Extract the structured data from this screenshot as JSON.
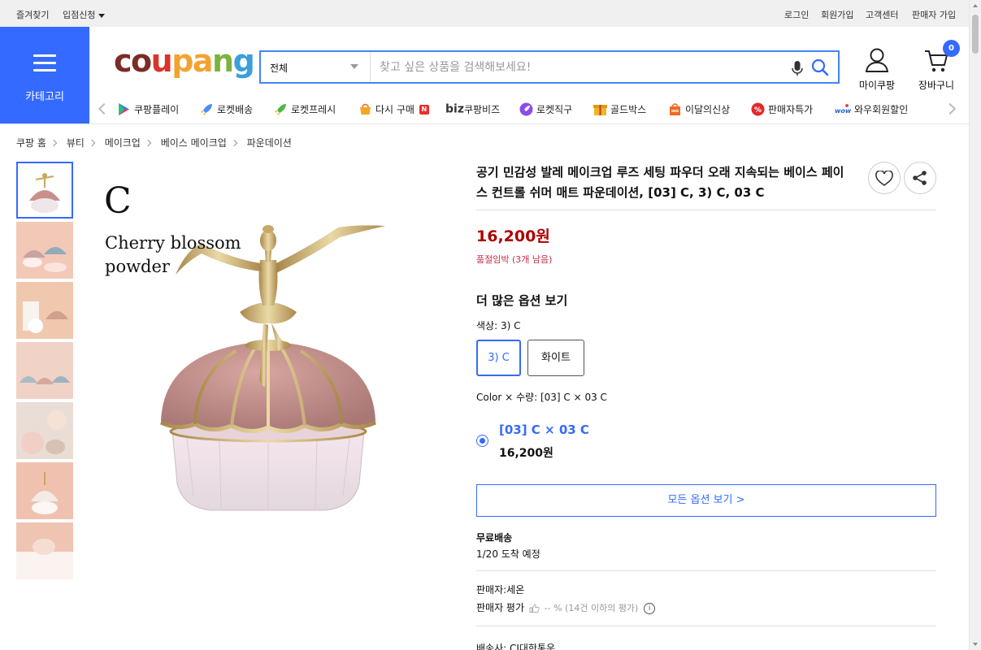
{
  "topbar": {
    "bookmark": "즐겨찾기",
    "seller_apply": "입점신청",
    "login": "로그인",
    "signup": "회원가입",
    "customer_center": "고객센터",
    "seller_signup": "판매자 가입"
  },
  "header": {
    "category_label": "카테고리",
    "logo": [
      "co",
      "u",
      "pa",
      "n",
      "g"
    ],
    "search": {
      "category": "전체",
      "placeholder": "찾고 싶은 상품을 검색해보세요!"
    },
    "mycoupang": "마이쿠팡",
    "cart": "장바구니",
    "cart_count": "0"
  },
  "nav": {
    "items": [
      {
        "label": "쿠팡플레이",
        "icon": "play-icon"
      },
      {
        "label": "로켓배송",
        "icon": "rocket-icon"
      },
      {
        "label": "로켓프레시",
        "icon": "rocket-fresh-icon"
      },
      {
        "label": "다시 구매",
        "icon": "rebuy-icon"
      },
      {
        "label": "쿠팡비즈",
        "icon": "biz-icon"
      },
      {
        "label": "로켓직구",
        "icon": "rocket-global-icon"
      },
      {
        "label": "골드박스",
        "icon": "goldbox-icon"
      },
      {
        "label": "이달의신상",
        "icon": "new-arrival-icon"
      },
      {
        "label": "판매자특가",
        "icon": "discount-icon"
      },
      {
        "label": "와우회원할인",
        "icon": "wow-icon"
      }
    ],
    "biz_prefix": "biz"
  },
  "breadcrumb": [
    "쿠팡 홈",
    "뷰티",
    "메이크업",
    "베이스 메이크업",
    "파운데이션"
  ],
  "image": {
    "letter": "C",
    "line1": "Cherry blossom",
    "line2": "powder"
  },
  "product": {
    "title": "공기 민감성 발레 메이크업 루즈 세팅 파우더 오래 지속되는 베이스 페이스 컨트롤 쉬머 매트 파운데이션, [03] C, 3) C, 03 C",
    "price": "16,200원",
    "stock_note": "품절임박 (3개 남음)",
    "more_options": "더 많은 옵션 보기",
    "color_label": "색상: 3) C",
    "chips": [
      "3) C",
      "화이트"
    ],
    "combo_label": "Color × 수량: [03] C × 03 C",
    "selected_option": "[03] C × 03 C",
    "selected_price": "16,200원",
    "all_options_btn": "모든 옵션 보기 >",
    "shipping_title": "무료배송",
    "shipping_eta": "1/20 도착 예정",
    "seller": "판매자:세온",
    "seller_rating_label": "판매자 평가",
    "seller_rating_value": "-- % (14건 이하의 평가)",
    "carrier": "배송사: CJ대한통운"
  },
  "colors": {
    "accent": "#346aff",
    "price": "#ae0000",
    "stock": "#c62e4d"
  }
}
